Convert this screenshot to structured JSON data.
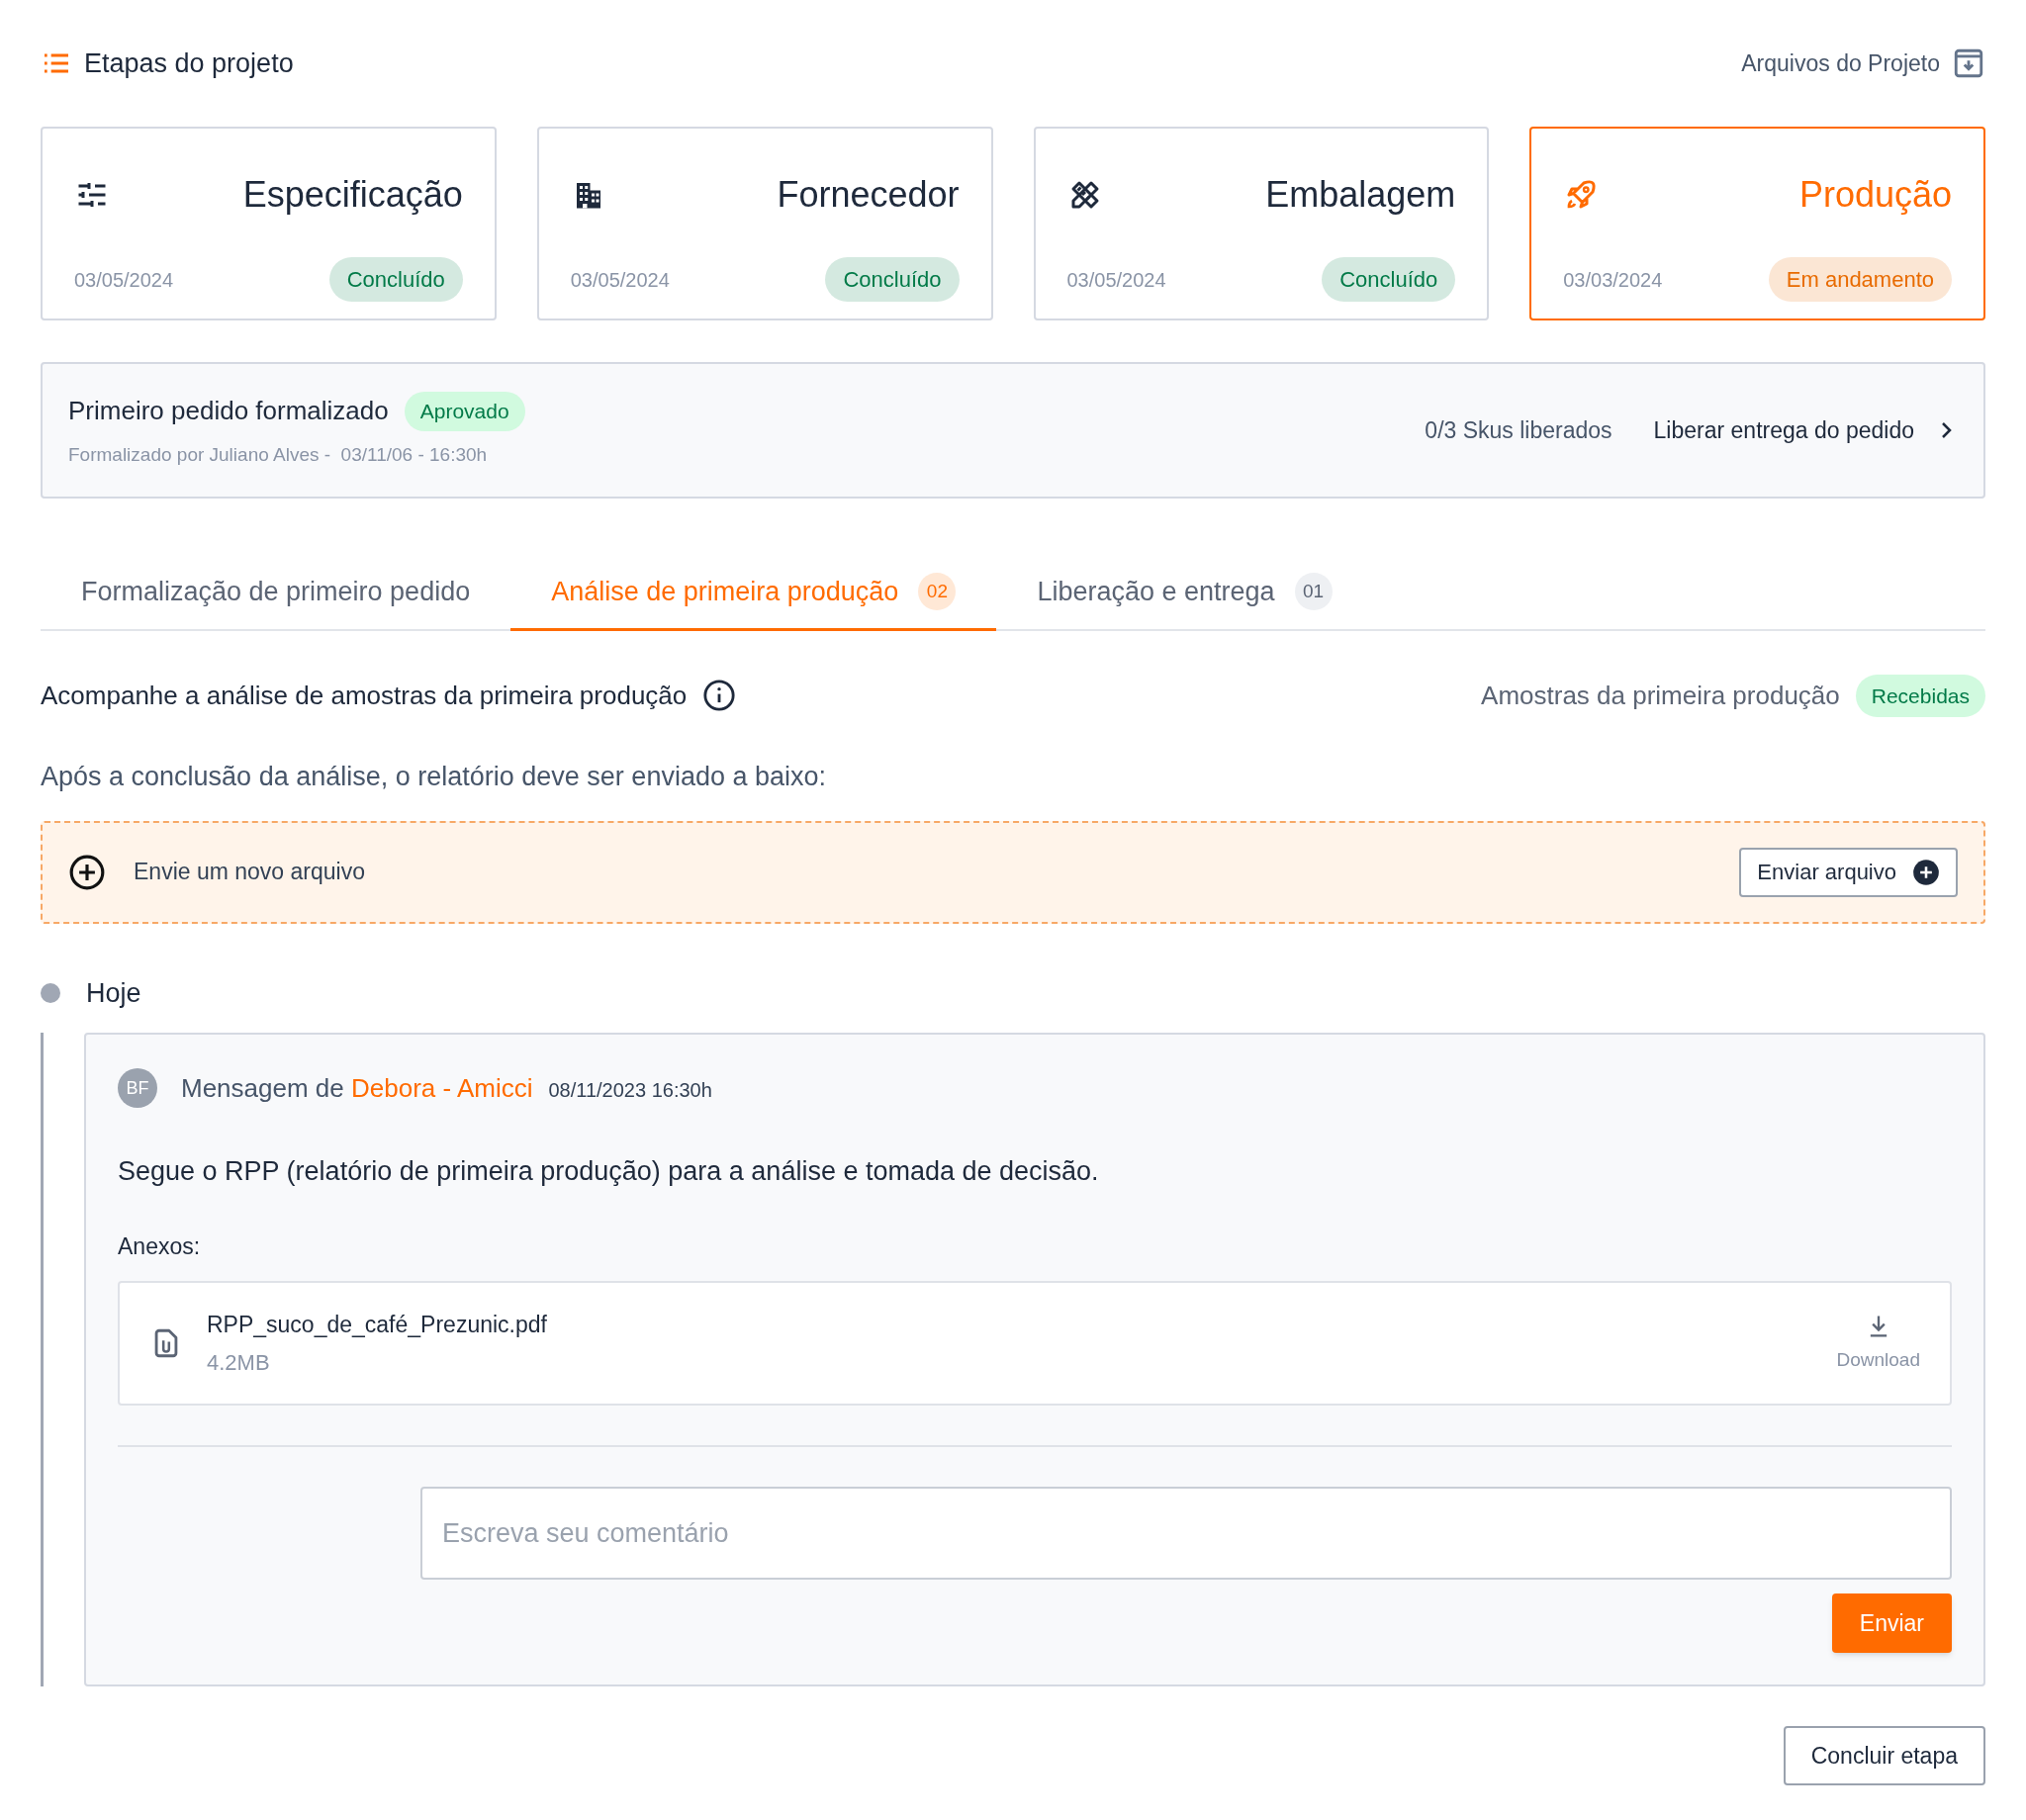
{
  "header": {
    "title": "Etapas do projeto",
    "files_link": "Arquivos do Projeto"
  },
  "stages": [
    {
      "kind": "specification",
      "title": "Especificação",
      "date": "03/05/2024",
      "status": "Concluído",
      "color": "#027a48",
      "selected": false
    },
    {
      "kind": "supplier",
      "title": "Fornecedor",
      "date": "03/05/2024",
      "status": "Concluído",
      "color": "#027a48",
      "selected": false
    },
    {
      "kind": "packaging",
      "title": "Embalagem",
      "date": "03/05/2024",
      "status": "Concluído",
      "color": "#027a48",
      "selected": false
    },
    {
      "kind": "production",
      "title": "Produção",
      "date": "03/03/2024",
      "status": "Em andamento",
      "color": "#e86b00",
      "selected": true
    }
  ],
  "order_banner": {
    "title": "Primeiro pedido formalizado",
    "badge": "Aprovado",
    "subtitle": "Formalizado por Juliano Alves -  03/11/06 - 16:30h",
    "skus": "0/3 Skus liberados",
    "action": "Liberar entrega do pedido"
  },
  "tabs": [
    {
      "label": "Formalização de primeiro pedido",
      "selected": false
    },
    {
      "label": "Análise de primeira produção",
      "count": "02",
      "selected": true
    },
    {
      "label": "Liberação e entrega",
      "count": "01",
      "selected": false
    }
  ],
  "section": {
    "title": "Acompanhe a análise de amostras da primeira produção",
    "samples_label": "Amostras da primeira produção",
    "samples_badge": "Recebidas",
    "instruction": "Após a conclusão da análise, o relatório deve ser enviado a baixo:"
  },
  "upload": {
    "label": "Envie um novo arquivo",
    "button": "Enviar arquivo"
  },
  "timeline": {
    "day": "Hoje",
    "message": {
      "avatar": "BF",
      "prefix": "Mensagem de",
      "author": "Debora - Amicci",
      "time": "08/11/2023 16:30h",
      "body": "Segue o RPP (relatório de primeira produção) para a análise e tomada de decisão.",
      "attachments_label": "Anexos:",
      "attachments": [
        {
          "name": "RPP_suco_de_café_Prezunic.pdf",
          "size": "4.2MB",
          "action": "Download"
        }
      ],
      "comment_placeholder": "Escreva seu comentário",
      "send": "Enviar"
    }
  },
  "footer": {
    "button": "Concluir etapa"
  }
}
